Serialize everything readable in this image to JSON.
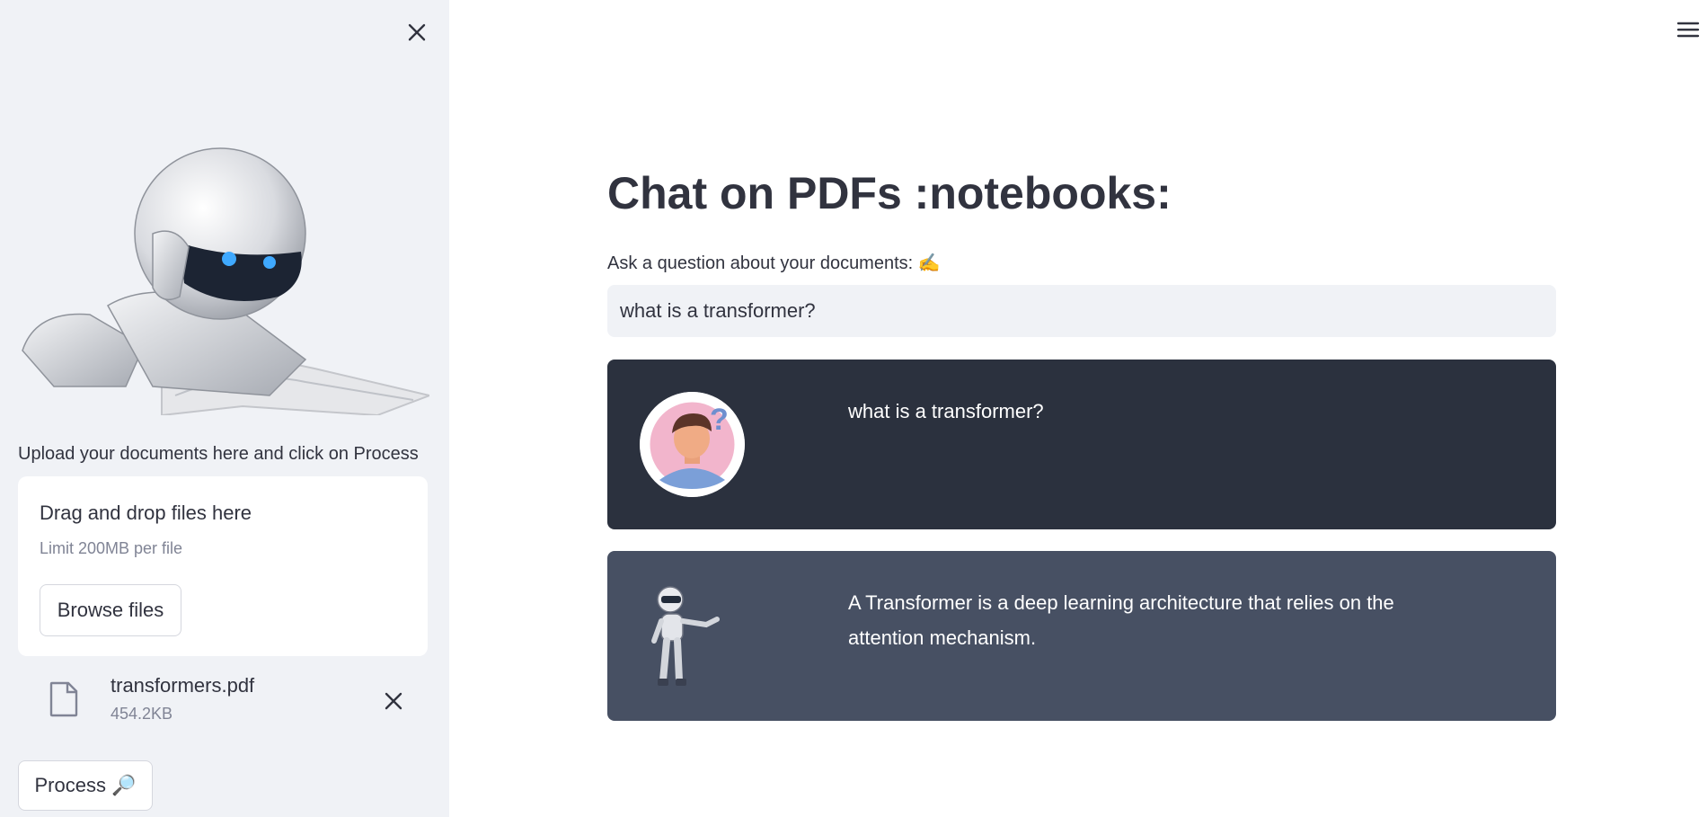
{
  "sidebar": {
    "upload_label": "Upload your documents here and click on Process",
    "dropzone": {
      "title": "Drag and drop files here",
      "limit": "Limit 200MB per file",
      "browse_label": "Browse files"
    },
    "file": {
      "name": "transformers.pdf",
      "size": "454.2KB"
    },
    "process_label": "Process 🔎"
  },
  "main": {
    "title": "Chat on PDFs :notebooks:",
    "ask_label": "Ask a question about your documents: ✍️",
    "question_value": "what is a transformer?",
    "messages": [
      {
        "role": "user",
        "text": "what is a transformer?"
      },
      {
        "role": "bot",
        "text": "A Transformer is a deep learning architecture that relies on the attention mechanism."
      }
    ]
  },
  "colors": {
    "sidebar_bg": "#f0f2f6",
    "user_msg_bg": "#2b313e",
    "bot_msg_bg": "#475063",
    "text": "#31333f"
  },
  "icons": {
    "sidebar_close": "close-icon",
    "menu": "hamburger-menu-icon",
    "file": "file-icon",
    "file_remove": "close-icon"
  }
}
